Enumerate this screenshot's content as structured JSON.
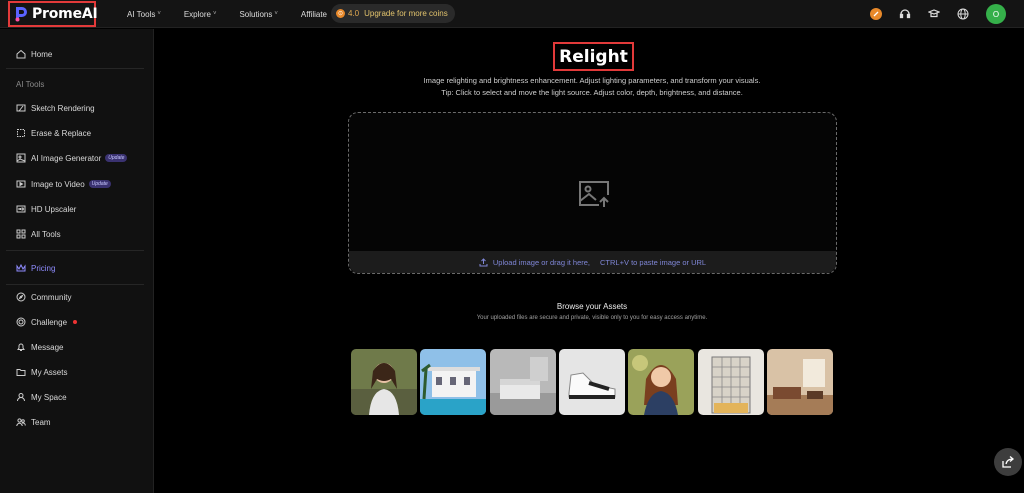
{
  "brand": {
    "name": "PromeAI"
  },
  "nav": {
    "items": [
      {
        "label": "AI Tools",
        "chevron": "˅"
      },
      {
        "label": "Explore",
        "chevron": "˅"
      },
      {
        "label": "Solutions",
        "chevron": "˅"
      },
      {
        "label": "Affiliate",
        "chevron": ""
      }
    ],
    "coins": {
      "value": "4.0",
      "upgrade_label": "Upgrade for more coins"
    },
    "avatar_initial": "O",
    "icons": [
      "coin-icon",
      "headset-icon",
      "graduation-cap-icon",
      "globe-icon"
    ]
  },
  "sidebar": {
    "home": "Home",
    "section_label": "AI Tools",
    "tools": [
      {
        "label": "Sketch Rendering",
        "icon": "sketch-icon",
        "badge": ""
      },
      {
        "label": "Erase & Replace",
        "icon": "erase-icon",
        "badge": ""
      },
      {
        "label": "AI Image Generator",
        "icon": "image-generator-icon",
        "badge": "Update"
      },
      {
        "label": "Image to Video",
        "icon": "video-icon",
        "badge": "Update"
      },
      {
        "label": "HD Upscaler",
        "icon": "hd-icon",
        "badge": ""
      },
      {
        "label": "All Tools",
        "icon": "grid-icon",
        "badge": ""
      }
    ],
    "pricing": "Pricing",
    "community": [
      {
        "label": "Community",
        "icon": "compass-icon"
      },
      {
        "label": "Challenge",
        "icon": "target-icon"
      },
      {
        "label": "Message",
        "icon": "bell-icon"
      },
      {
        "label": "My Assets",
        "icon": "folder-icon"
      },
      {
        "label": "My Space",
        "icon": "user-icon"
      },
      {
        "label": "Team",
        "icon": "team-icon"
      }
    ]
  },
  "main": {
    "title": "Relight",
    "description": "Image relighting and brightness enhancement. Adjust lighting parameters, and transform your visuals.",
    "tip": "Tip: Click to select and move the light source. Adjust color, depth, brightness, and distance.",
    "upload": {
      "upload_label": "Upload image or drag it here,",
      "paste_label": "CTRL+V to paste image or URL"
    },
    "assets": {
      "title": "Browse your Assets",
      "subtitle": "Your uploaded files are secure and private, visible only to you for easy access anytime.",
      "thumbnails": [
        "girl-portrait",
        "villa-pool",
        "white-bedroom",
        "sneaker",
        "girl-illustration",
        "building-sketch",
        "living-room"
      ]
    }
  },
  "colors": {
    "accent": "#8f8cff",
    "highlight_box": "#e23a3a",
    "coin": "#e8892a",
    "avatar": "#35b04a"
  }
}
